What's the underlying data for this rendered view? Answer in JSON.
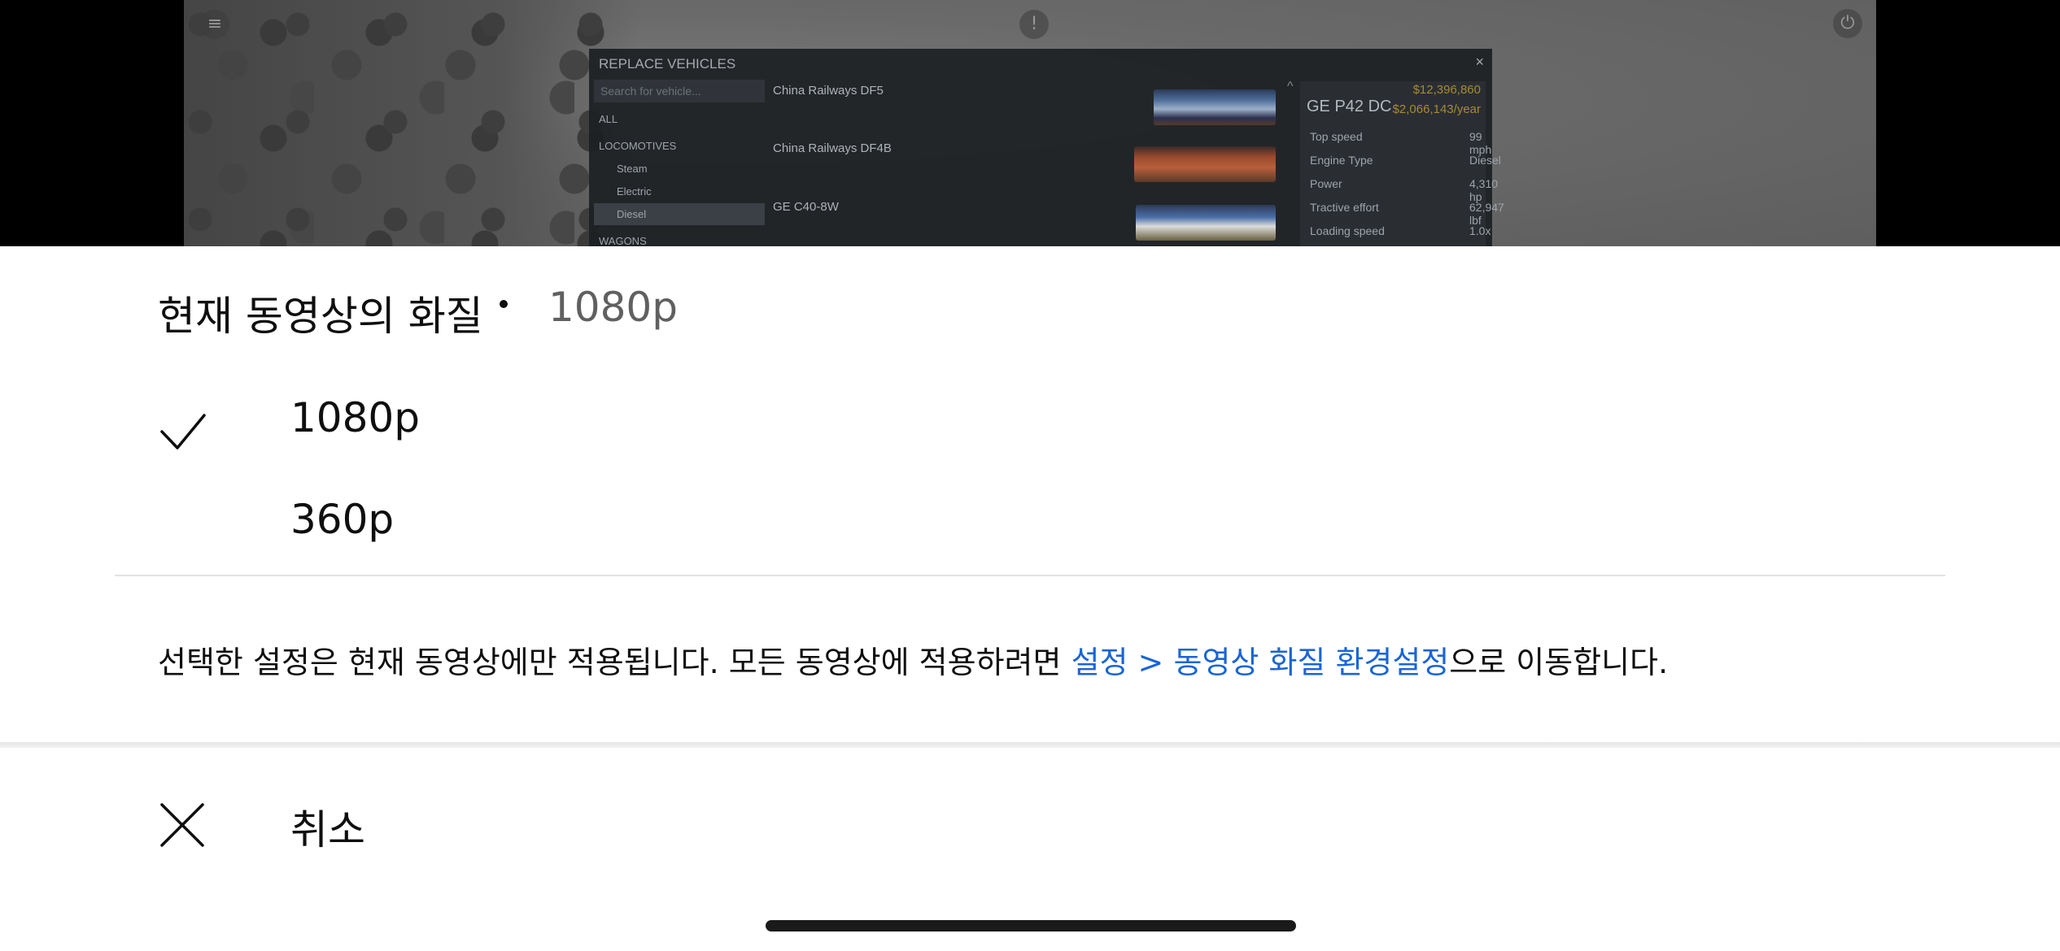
{
  "game_dialog": {
    "title": "REPLACE VEHICLES",
    "close": "×",
    "search_placeholder": "Search for vehicle...",
    "categories": {
      "all": "ALL",
      "locomotives": "LOCOMOTIVES",
      "steam": "Steam",
      "electric": "Electric",
      "diesel": "Diesel",
      "wagons": "WAGONS"
    },
    "vehicles": [
      "China Railways DF5",
      "China Railways DF4B",
      "GE C40-8W"
    ],
    "scroll_up": "^",
    "detail": {
      "name": "GE P42 DC",
      "price": "$12,396,860",
      "upkeep": "$2,066,143/year",
      "specs": [
        {
          "key": "Top speed",
          "value": "99 mph"
        },
        {
          "key": "Engine Type",
          "value": "Diesel"
        },
        {
          "key": "Power",
          "value": "4,310 hp"
        },
        {
          "key": "Tractive effort",
          "value": "62,947 lbf"
        },
        {
          "key": "Loading speed",
          "value": "1.0x"
        }
      ]
    }
  },
  "sheet": {
    "title": "현재 동영상의 화질",
    "current_quality": "1080p",
    "options": [
      {
        "label": "1080p",
        "selected": true
      },
      {
        "label": "360p",
        "selected": false
      }
    ],
    "note_prefix": "선택한 설정은 현재 동영상에만 적용됩니다. 모든 동영상에 적용하려면 ",
    "note_link": "설정 > 동영상 화질 환경설정",
    "note_suffix": "으로 이동합니다.",
    "cancel_label": "취소"
  },
  "icons": {
    "check": "check-icon",
    "cancel": "close-icon",
    "layers": "layers-icon",
    "info": "info-icon",
    "power": "power-icon"
  },
  "colors": {
    "link": "#1a65d6",
    "text": "#0f0f0f",
    "secondary_text": "#606060",
    "price": "#a88a34"
  }
}
